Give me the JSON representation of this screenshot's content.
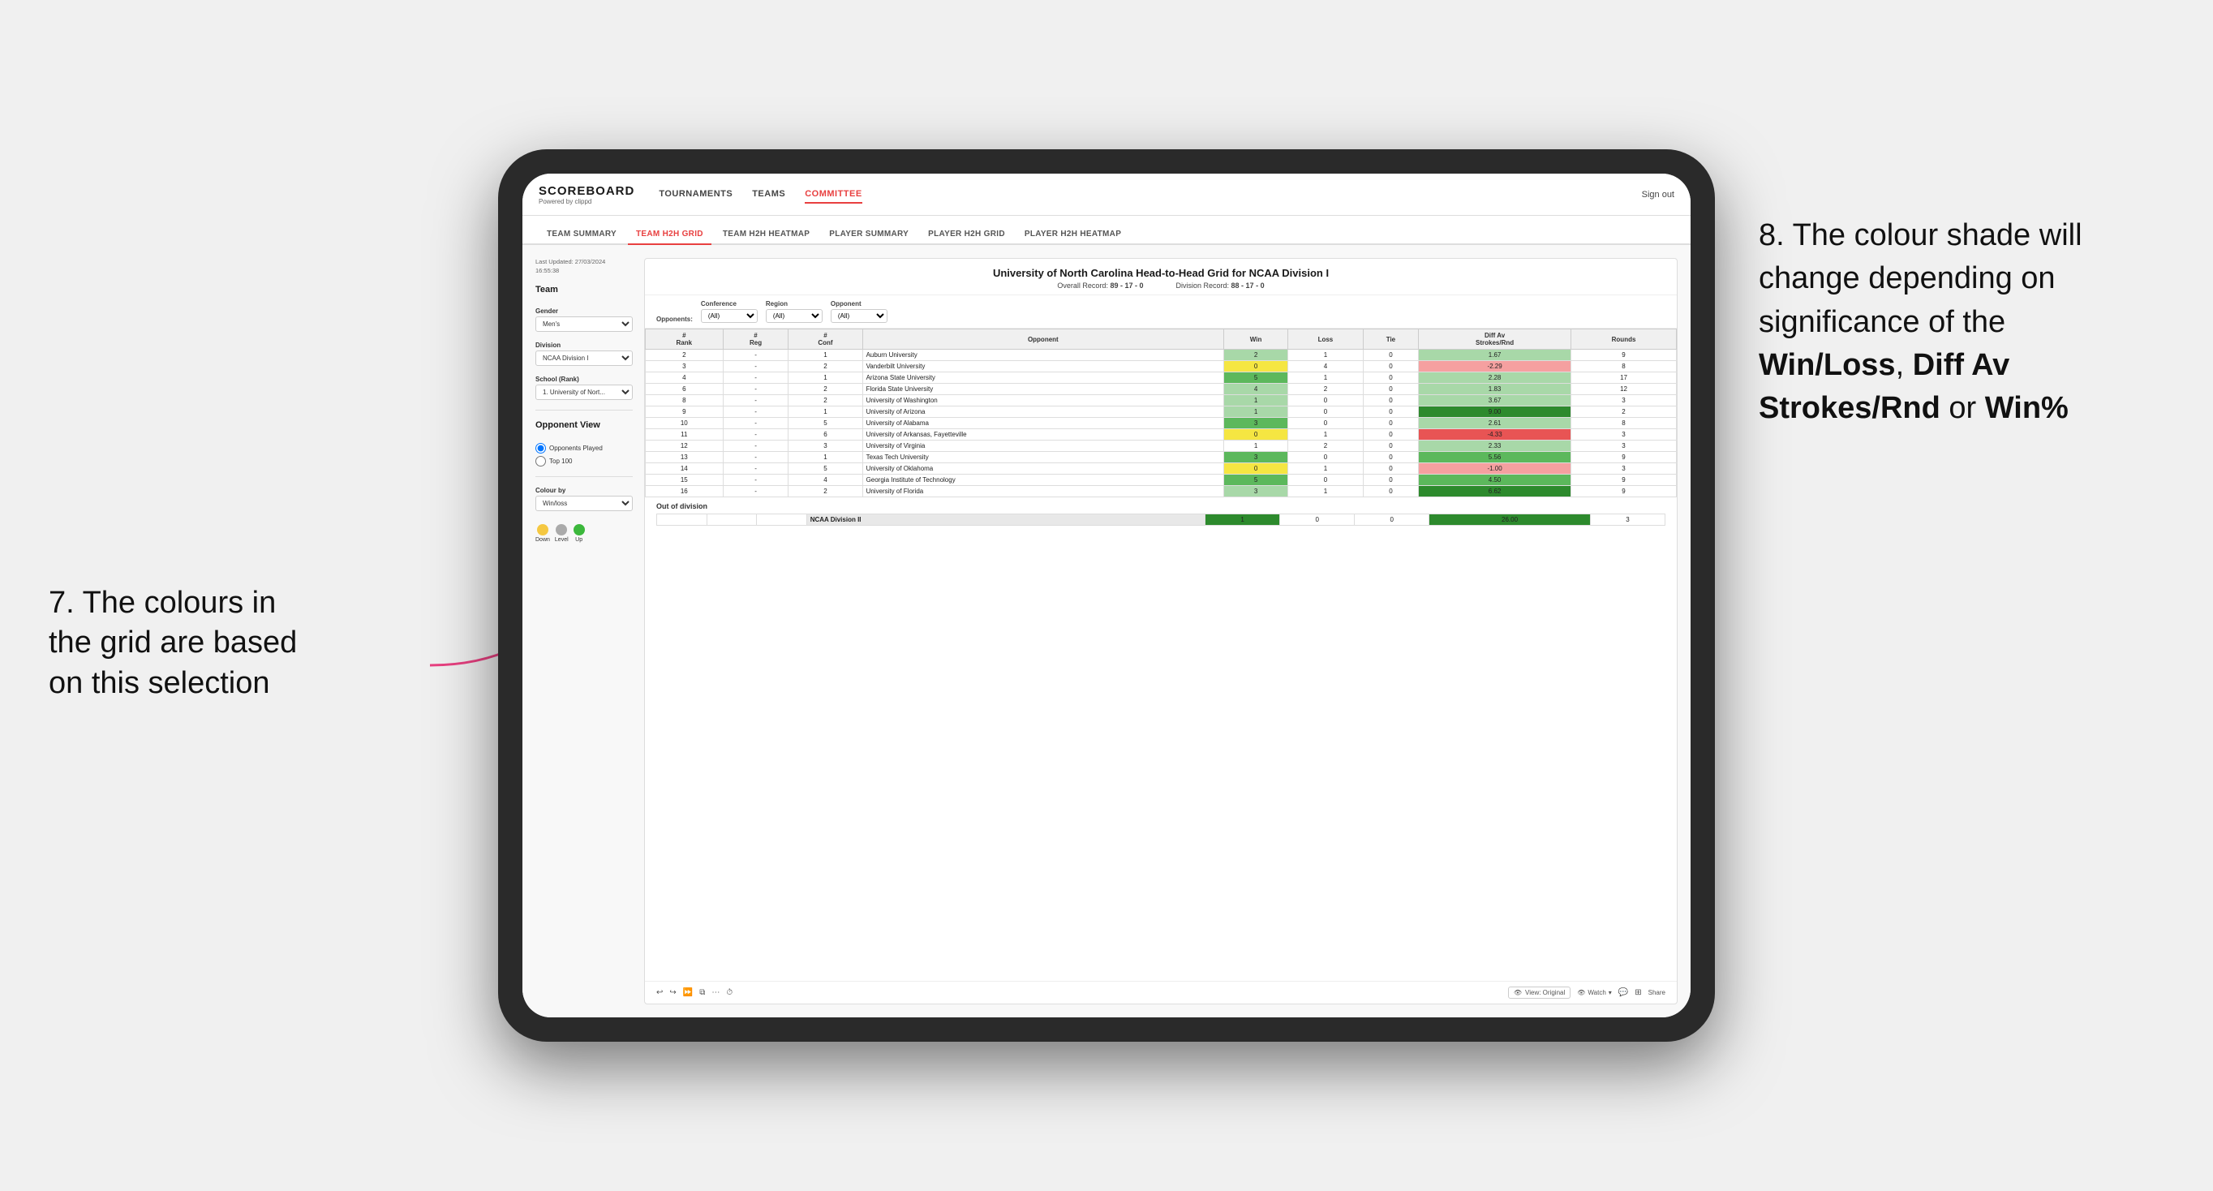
{
  "annotations": {
    "left_title": "7. The colours in the grid are based on this selection",
    "right_title": "8. The colour shade will change depending on significance of the",
    "right_bold1": "Win/Loss",
    "right_bold2": "Diff Av Strokes/Rnd",
    "right_bold3": "Win%",
    "right_connector": "or"
  },
  "nav": {
    "logo": "SCOREBOARD",
    "logo_sub": "Powered by clippd",
    "links": [
      "TOURNAMENTS",
      "TEAMS",
      "COMMITTEE"
    ],
    "sign_out": "Sign out"
  },
  "sec_tabs": [
    "TEAM SUMMARY",
    "TEAM H2H GRID",
    "TEAM H2H HEATMAP",
    "PLAYER SUMMARY",
    "PLAYER H2H GRID",
    "PLAYER H2H HEATMAP"
  ],
  "active_sec_tab": "TEAM H2H GRID",
  "sidebar": {
    "last_updated_label": "Last Updated: 27/03/2024",
    "last_updated_time": "16:55:38",
    "team_label": "Team",
    "gender_label": "Gender",
    "gender_value": "Men's",
    "division_label": "Division",
    "division_value": "NCAA Division I",
    "school_label": "School (Rank)",
    "school_value": "1. University of Nort...",
    "opponent_view_label": "Opponent View",
    "radio1": "Opponents Played",
    "radio2": "Top 100",
    "colour_by_label": "Colour by",
    "colour_by_value": "Win/loss",
    "legend_down": "Down",
    "legend_level": "Level",
    "legend_up": "Up"
  },
  "grid": {
    "title": "University of North Carolina Head-to-Head Grid for NCAA Division I",
    "overall_record_label": "Overall Record:",
    "overall_record": "89 - 17 - 0",
    "division_record_label": "Division Record:",
    "division_record": "88 - 17 - 0",
    "filters": {
      "opponents_label": "Opponents:",
      "opponents_value": "(All)",
      "conference_label": "Conference",
      "conference_value": "(All)",
      "region_label": "Region",
      "region_value": "(All)",
      "opponent_label": "Opponent",
      "opponent_value": "(All)"
    },
    "col_headers": [
      "#\nRank",
      "#\nReg",
      "#\nConf",
      "Opponent",
      "Win",
      "Loss",
      "Tie",
      "Diff Av\nStrokes/Rnd",
      "Rounds"
    ],
    "rows": [
      {
        "rank": "2",
        "reg": "-",
        "conf": "1",
        "opponent": "Auburn University",
        "win": "2",
        "loss": "1",
        "tie": "0",
        "diff": "1.67",
        "rounds": "9",
        "win_color": "green-light",
        "loss_color": "plain",
        "diff_color": "green-light"
      },
      {
        "rank": "3",
        "reg": "-",
        "conf": "2",
        "opponent": "Vanderbilt University",
        "win": "0",
        "loss": "4",
        "tie": "0",
        "diff": "-2.29",
        "rounds": "8",
        "win_color": "yellow",
        "loss_color": "plain",
        "diff_color": "red-light"
      },
      {
        "rank": "4",
        "reg": "-",
        "conf": "1",
        "opponent": "Arizona State University",
        "win": "5",
        "loss": "1",
        "tie": "0",
        "diff": "2.28",
        "rounds": "17",
        "win_color": "green-med",
        "loss_color": "plain",
        "diff_color": "green-light"
      },
      {
        "rank": "6",
        "reg": "-",
        "conf": "2",
        "opponent": "Florida State University",
        "win": "4",
        "loss": "2",
        "tie": "0",
        "diff": "1.83",
        "rounds": "12",
        "win_color": "green-light",
        "loss_color": "plain",
        "diff_color": "green-light"
      },
      {
        "rank": "8",
        "reg": "-",
        "conf": "2",
        "opponent": "University of Washington",
        "win": "1",
        "loss": "0",
        "tie": "0",
        "diff": "3.67",
        "rounds": "3",
        "win_color": "green-light",
        "loss_color": "plain",
        "diff_color": "green-light"
      },
      {
        "rank": "9",
        "reg": "-",
        "conf": "1",
        "opponent": "University of Arizona",
        "win": "1",
        "loss": "0",
        "tie": "0",
        "diff": "9.00",
        "rounds": "2",
        "win_color": "green-light",
        "loss_color": "plain",
        "diff_color": "green-dark"
      },
      {
        "rank": "10",
        "reg": "-",
        "conf": "5",
        "opponent": "University of Alabama",
        "win": "3",
        "loss": "0",
        "tie": "0",
        "diff": "2.61",
        "rounds": "8",
        "win_color": "green-med",
        "loss_color": "plain",
        "diff_color": "green-light"
      },
      {
        "rank": "11",
        "reg": "-",
        "conf": "6",
        "opponent": "University of Arkansas, Fayetteville",
        "win": "0",
        "loss": "1",
        "tie": "0",
        "diff": "-4.33",
        "rounds": "3",
        "win_color": "yellow",
        "loss_color": "plain",
        "diff_color": "red-med"
      },
      {
        "rank": "12",
        "reg": "-",
        "conf": "3",
        "opponent": "University of Virginia",
        "win": "1",
        "loss": "2",
        "tie": "0",
        "diff": "2.33",
        "rounds": "3",
        "win_color": "plain",
        "loss_color": "plain",
        "diff_color": "green-light"
      },
      {
        "rank": "13",
        "reg": "-",
        "conf": "1",
        "opponent": "Texas Tech University",
        "win": "3",
        "loss": "0",
        "tie": "0",
        "diff": "5.56",
        "rounds": "9",
        "win_color": "green-med",
        "loss_color": "plain",
        "diff_color": "green-med"
      },
      {
        "rank": "14",
        "reg": "-",
        "conf": "5",
        "opponent": "University of Oklahoma",
        "win": "0",
        "loss": "1",
        "tie": "0",
        "diff": "-1.00",
        "rounds": "3",
        "win_color": "yellow",
        "loss_color": "plain",
        "diff_color": "red-light"
      },
      {
        "rank": "15",
        "reg": "-",
        "conf": "4",
        "opponent": "Georgia Institute of Technology",
        "win": "5",
        "loss": "0",
        "tie": "0",
        "diff": "4.50",
        "rounds": "9",
        "win_color": "green-med",
        "loss_color": "plain",
        "diff_color": "green-med"
      },
      {
        "rank": "16",
        "reg": "-",
        "conf": "2",
        "opponent": "University of Florida",
        "win": "3",
        "loss": "1",
        "tie": "0",
        "diff": "6.62",
        "rounds": "9",
        "win_color": "green-light",
        "loss_color": "plain",
        "diff_color": "green-dark"
      }
    ],
    "ood_title": "Out of division",
    "ood_rows": [
      {
        "division": "NCAA Division II",
        "win": "1",
        "loss": "0",
        "tie": "0",
        "diff": "26.00",
        "rounds": "3",
        "win_color": "green-dark",
        "diff_color": "green-dark"
      }
    ],
    "toolbar": {
      "view_label": "View: Original",
      "watch_label": "Watch",
      "share_label": "Share"
    }
  }
}
